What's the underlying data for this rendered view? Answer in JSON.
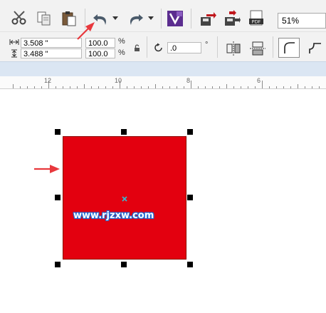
{
  "toolbar": {
    "zoom_value": "51%",
    "tools": [
      "scissors-icon",
      "copy-icon",
      "paste-icon",
      "undo-icon",
      "redo-icon",
      "launcher-icon",
      "import-icon",
      "export-icon",
      "pdf-icon"
    ]
  },
  "property_bar": {
    "width_value": "3.508 \"",
    "height_value": "3.488 \"",
    "scale_x": "100.0",
    "scale_y": "100.0",
    "percent_symbol": "%",
    "rotation_value": ".0",
    "degree_symbol": "°"
  },
  "ruler": {
    "labels": [
      "12",
      "10",
      "8",
      "6"
    ]
  },
  "canvas": {
    "shape_color": "#e3000f",
    "watermark": "www.rjzxw.com",
    "annotation_color": "#e8383d"
  }
}
